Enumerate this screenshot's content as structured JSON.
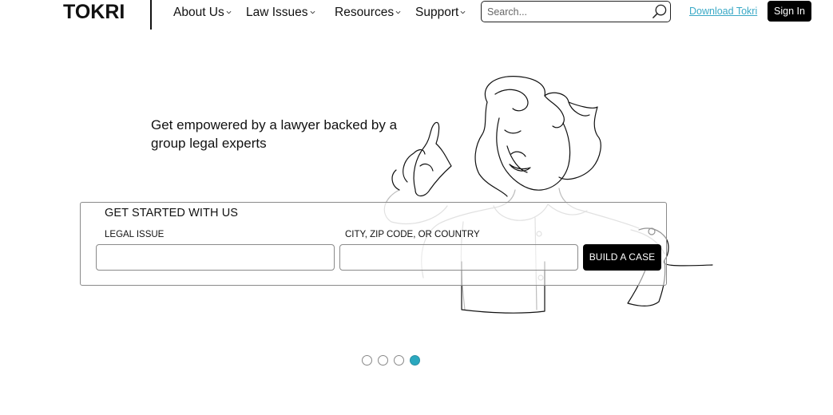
{
  "header": {
    "logo": "TOKRI",
    "nav": [
      {
        "label": "About Us",
        "icon": "chevron-down-icon"
      },
      {
        "label": "Law Issues",
        "icon": "chevron-down-icon"
      },
      {
        "label": "Resources",
        "icon": "chevron-down-icon"
      },
      {
        "label": "Support",
        "icon": "chevron-down-icon"
      }
    ],
    "search": {
      "placeholder": "Search...",
      "icon": "search-icon"
    },
    "download_label": "Download Tokri",
    "signin_label": "Sign In"
  },
  "hero": {
    "headline": "Get empowered by a lawyer backed by a group legal experts",
    "form": {
      "title": "GET STARTED WITH US",
      "legal_issue_label": "LEGAL ISSUE",
      "legal_issue_value": "",
      "location_label": "CITY, ZIP CODE, OR COUNTRY",
      "location_value": "",
      "submit_label": "BUILD A CASE"
    }
  },
  "carousel": {
    "slide_count": 4,
    "active_index": 3
  },
  "colors": {
    "accent": "#2aa8bf",
    "link": "#3aa9c6",
    "button_bg": "#000000"
  }
}
